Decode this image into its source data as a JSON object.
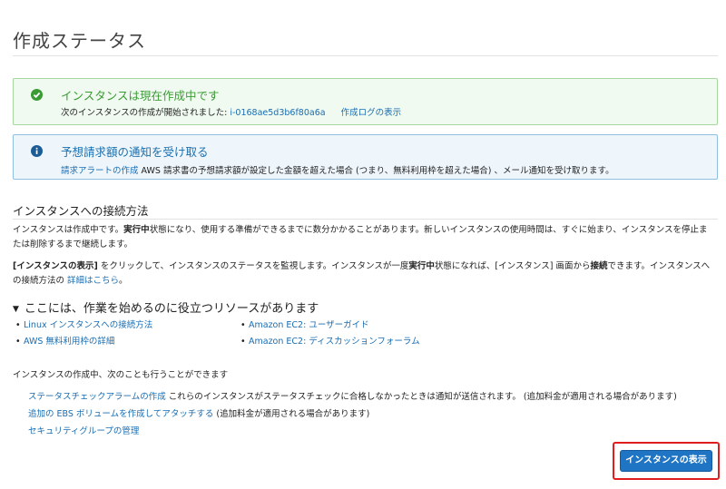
{
  "page_title": "作成ステータス",
  "success_alert": {
    "title": "インスタンスは現在作成中です",
    "body_prefix": "次のインスタンスの作成が開始されました: ",
    "instance_id": "i-0168ae5d3b6f80a6a",
    "log_link": "作成ログの表示",
    "color": "#3a9b34"
  },
  "info_alert": {
    "title": "予想請求額の通知を受け取る",
    "link": "請求アラートの作成",
    "body": " AWS 請求書の予想請求額が設定した金額を超えた場合 (つまり、無料利用枠を超えた場合) 、メール通知を受け取ります。",
    "color": "#1b6fad"
  },
  "connect_section": {
    "title": "インスタンスへの接続方法",
    "p1_a": "インスタンスは作成中です。",
    "p1_b": "実行中",
    "p1_c": "状態になり、使用する準備ができるまでに数分かかることがあります。新しいインスタンスの使用時間は、すぐに始まり、インスタンスを停止または削除するまで継続します。",
    "p2_a": "[インスタンスの表示]",
    "p2_b": " をクリックして、インスタンスのステータスを監視します。インスタンスが一度",
    "p2_c": "実行中",
    "p2_d": "状態になれば、[インスタンス] 画面から",
    "p2_e": "接続",
    "p2_f": "できます。インスタンスへの接続方法の ",
    "p2_link": "詳細はこちら",
    "p2_g": "。"
  },
  "resources": {
    "heading": "ここには、作業を始めるのに役立つリソースがあります",
    "left": [
      "Linux インスタンスへの接続方法",
      "AWS 無料利用枠の詳細"
    ],
    "right": [
      "Amazon EC2: ユーザーガイド",
      "Amazon EC2: ディスカッションフォーラム"
    ]
  },
  "also_do": {
    "label": "インスタンスの作成中、次のことも行うことができます",
    "item1_link": "ステータスチェックアラームの作成",
    "item1_text": " これらのインスタンスがステータスチェックに合格しなかったときは通知が送信されます。 (追加料金が適用される場合があります)",
    "item2_link": "追加の EBS ボリュームを作成してアタッチする",
    "item2_text": " (追加料金が適用される場合があります)",
    "item3_link": "セキュリティグループの管理"
  },
  "view_instances_button": "インスタンスの表示",
  "colors": {
    "link": "#1a6db1",
    "button": "#1f74c4",
    "highlight": "#e11d1d"
  }
}
